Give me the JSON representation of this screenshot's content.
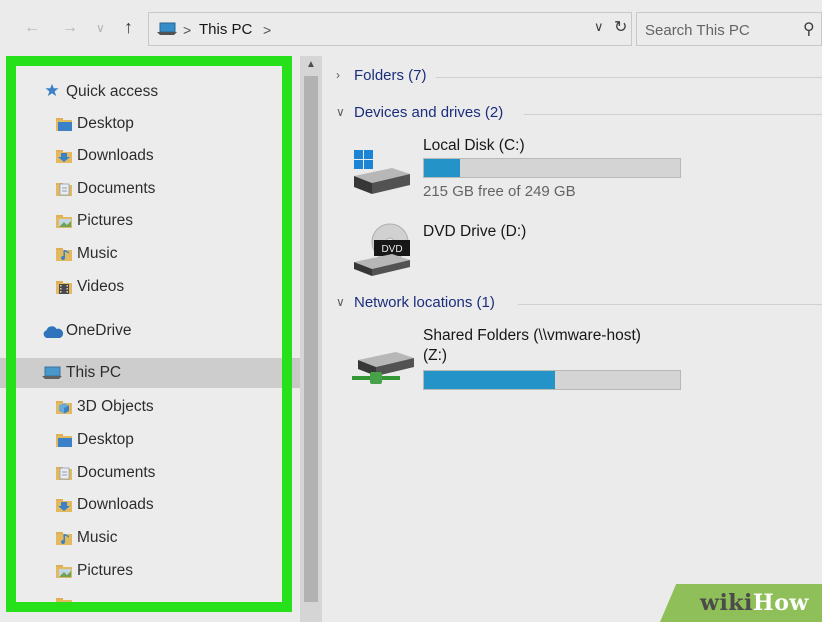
{
  "address_bar": {
    "back": "←",
    "forward": "→",
    "recent": "∨",
    "up": "↑",
    "breadcrumb": [
      "This PC"
    ],
    "separator": ">",
    "dropdown": "∨",
    "refresh": "↻",
    "search_placeholder": "Search This PC",
    "search_icon": "⚲"
  },
  "nav_pane": {
    "items": [
      {
        "label": "Quick access",
        "icon": "star-icon"
      },
      {
        "label": "Desktop",
        "icon": "folder-icon"
      },
      {
        "label": "Downloads",
        "icon": "download-folder-icon"
      },
      {
        "label": "Documents",
        "icon": "documents-folder-icon"
      },
      {
        "label": "Pictures",
        "icon": "pictures-folder-icon"
      },
      {
        "label": "Music",
        "icon": "music-folder-icon"
      },
      {
        "label": "Videos",
        "icon": "videos-folder-icon"
      },
      {
        "label": "OneDrive",
        "icon": "cloud-icon"
      },
      {
        "label": "This PC",
        "icon": "pc-icon",
        "selected": true
      },
      {
        "label": "3D Objects",
        "icon": "objects-folder-icon"
      },
      {
        "label": "Desktop",
        "icon": "folder-icon"
      },
      {
        "label": "Documents",
        "icon": "documents-folder-icon"
      },
      {
        "label": "Downloads",
        "icon": "download-folder-icon"
      },
      {
        "label": "Music",
        "icon": "music-folder-icon"
      },
      {
        "label": "Pictures",
        "icon": "pictures-folder-icon"
      }
    ]
  },
  "content": {
    "groups": {
      "folders": "Folders (7)",
      "devices": "Devices and drives (2)",
      "network": "Network locations (1)"
    },
    "drives": [
      {
        "name": "Local Disk (C:)",
        "free": "215 GB free of 249 GB",
        "used_fraction": 0.14
      },
      {
        "name": "DVD Drive (D:)",
        "badge": "DVD"
      },
      {
        "name_line1": "Shared Folders (\\\\vmware-host)",
        "name_line2": "(Z:)",
        "used_fraction": 0.51
      }
    ]
  },
  "colors": {
    "highlight_frame": "#2af31c",
    "bar_fill": "#26a0da",
    "group_header": "#1e3287"
  },
  "watermark": {
    "part1": "wiki",
    "part2": "How"
  }
}
